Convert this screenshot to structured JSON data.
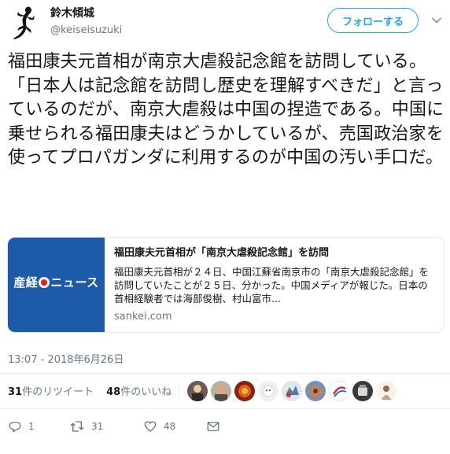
{
  "author": {
    "display_name": "鈴木傾城",
    "handle": "@keiseisuzuki"
  },
  "follow_label": "フォローする",
  "tweet_text": "福田康夫元首相が南京大虐殺記念館を訪問している。「日本人は記念館を訪問し歴史を理解すべきだ」と言っているのだが、南京大虐殺は中国の捏造である。中国に乗せられる福田康夫はどうかしているが、売国政治家を使ってプロパガンダに利用するのが中国の汚い手口だ。",
  "card": {
    "thumb_logo_left": "産経",
    "thumb_logo_right": "ニュース",
    "title": "福田康夫元首相が「南京大虐殺記念館」を訪問",
    "description": "福田康夫元首相が２４日、中国江蘇省南京市の「南京大虐殺記念館」を訪問していたことが２５日、分かった。中国メディアが報じた。日本の首相経験者では海部俊樹、村山富市...",
    "domain": "sankei.com"
  },
  "timestamp": "13:07 - 2018年6月26日",
  "stats": {
    "retweets_count": "31",
    "retweets_label": "件のリツイート",
    "likes_count": "48",
    "likes_label": "件のいいね"
  },
  "actions": {
    "reply_count": "1",
    "retweet_count": "31",
    "like_count": "48"
  },
  "icons": {
    "avatar": "gecko-logo-icon",
    "chevron": "chevron-down-icon",
    "reply": "reply-icon",
    "retweet": "retweet-icon",
    "like": "heart-icon",
    "dm": "envelope-icon"
  },
  "colors": {
    "accent": "#1da1f2",
    "card_thumb": "#1d5aa8",
    "secondary_text": "#657786"
  }
}
